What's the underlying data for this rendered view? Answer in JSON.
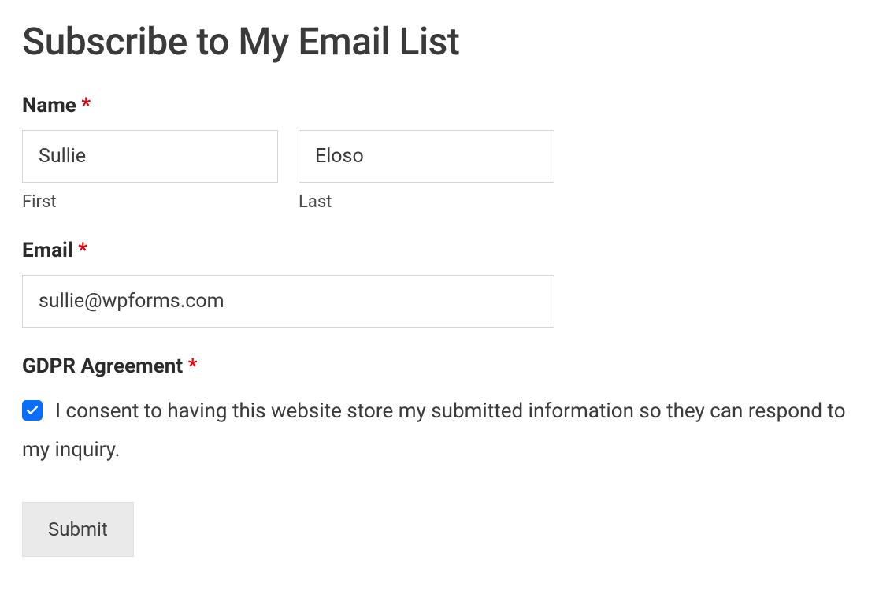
{
  "form": {
    "title": "Subscribe to My Email List",
    "required_marker": "*",
    "name": {
      "label": "Name",
      "first_value": "Sullie",
      "first_sublabel": "First",
      "last_value": "Eloso",
      "last_sublabel": "Last"
    },
    "email": {
      "label": "Email",
      "value": "sullie@wpforms.com"
    },
    "gdpr": {
      "label": "GDPR Agreement",
      "checked": true,
      "consent_text": "I consent to having this website store my submitted information so they can respond to my inquiry."
    },
    "submit_label": "Submit"
  }
}
